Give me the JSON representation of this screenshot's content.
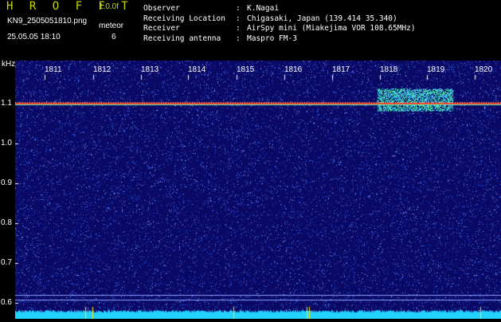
{
  "header": {
    "brand": "H R O F F T",
    "version": "1.0.0f",
    "filename": "KN9_2505051810.png",
    "timestamp": "25.05.05 18:10",
    "meteor_label": "meteor",
    "meteor_count": "6"
  },
  "info": [
    {
      "key": "Observer",
      "value": "K.Nagai"
    },
    {
      "key": "Receiving Location",
      "value": "Chigasaki, Japan (139.414 35.340)"
    },
    {
      "key": "Receiver",
      "value": "AirSpy mini (Miakejima VOR 108.65MHz)"
    },
    {
      "key": "Receiving antenna",
      "value": "Maspro FM-3"
    }
  ],
  "chart_data": {
    "type": "heatmap",
    "yunit": "kHz",
    "y_ticks": [
      "1.1",
      "1.0",
      "0.9",
      "0.8",
      "0.7",
      "0.6"
    ],
    "x_ticks": [
      "1811",
      "1812",
      "1813",
      "1814",
      "1815",
      "1816",
      "1817",
      "1818",
      "1819",
      "1820"
    ],
    "carrier_khz": 1.1
  },
  "colors": {
    "background": "#0a0a66",
    "noise": "#3d6cf5",
    "carrier": "#ff3b30",
    "bottom_strip": "#22d3ff",
    "accent": "#c8d800"
  }
}
